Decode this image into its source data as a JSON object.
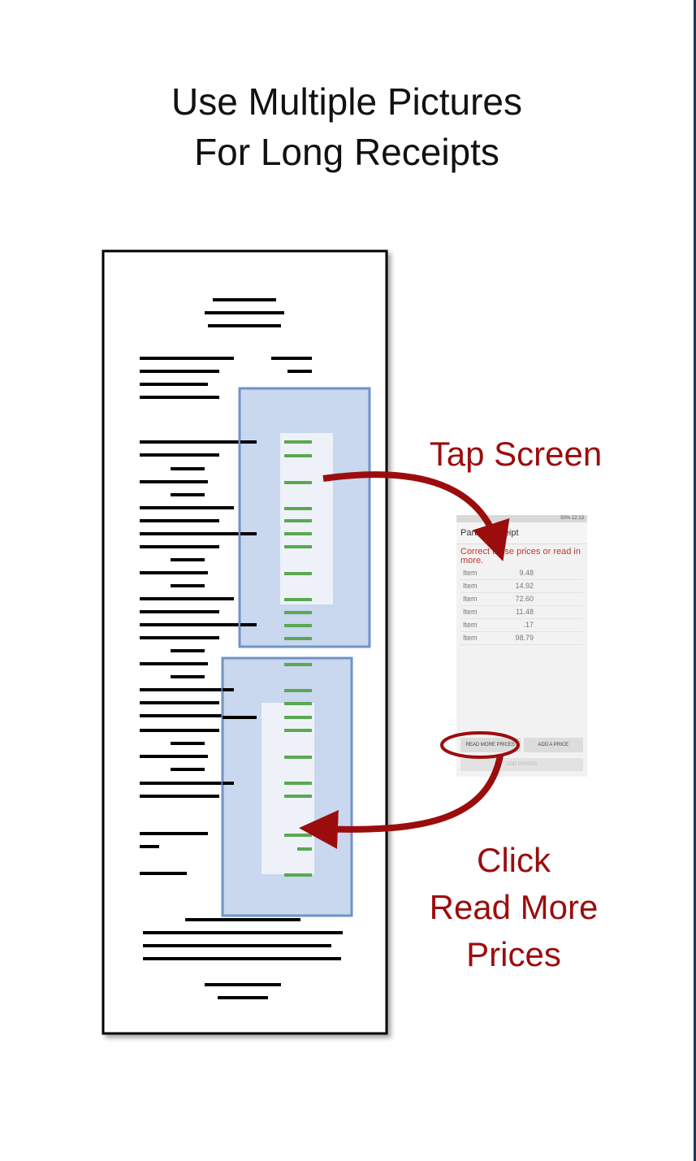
{
  "title": {
    "line1": "Use Multiple Pictures",
    "line2": "For Long Receipts"
  },
  "captions": {
    "tap": "Tap Screen",
    "click": [
      "Click",
      "Read More",
      "Prices"
    ]
  },
  "colors": {
    "accent": "#9b0d0d",
    "price_line": "#5aa852",
    "highlight_fill": "#c9d7ef",
    "highlight_stroke": "#6f93c9"
  },
  "phone": {
    "status": "50% 12:13",
    "app_title": "Partial Receipt",
    "warning": "Correct these prices or read in more.",
    "items": [
      {
        "label": "Item",
        "price": "9.48"
      },
      {
        "label": "Item",
        "price": "14.92"
      },
      {
        "label": "Item",
        "price": "72.60"
      },
      {
        "label": "Item",
        "price": "11.48"
      },
      {
        "label": "Item",
        "price": ".17"
      },
      {
        "label": "Item",
        "price": "98.79"
      }
    ],
    "buttons": {
      "read_more": "READ MORE PRICES",
      "add_price": "ADD A PRICE",
      "add_payers": "ADD PAYERS"
    }
  }
}
